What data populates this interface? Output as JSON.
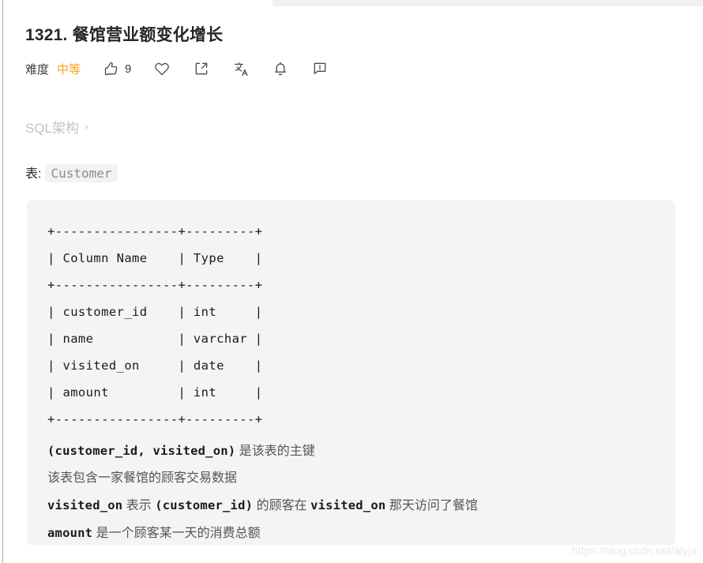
{
  "page": {
    "watermark": "https://blog.csdn.net/alyja"
  },
  "problem": {
    "title": "1321. 餐馆营业额变化增长",
    "difficulty_label": "难度",
    "difficulty_value": "中等",
    "difficulty_color": "#ffa116"
  },
  "actions": [
    {
      "name": "thumbs-up-icon",
      "label": "点赞",
      "count": "9"
    },
    {
      "name": "heart-icon",
      "label": "收藏",
      "count": ""
    },
    {
      "name": "share-icon",
      "label": "分享",
      "count": ""
    },
    {
      "name": "translate-icon",
      "label": "翻译",
      "count": ""
    },
    {
      "name": "bell-icon",
      "label": "订阅",
      "count": ""
    },
    {
      "name": "report-icon",
      "label": "反馈",
      "count": ""
    }
  ],
  "breadcrumb": {
    "label": "SQL架构",
    "chevron": "›"
  },
  "schema": {
    "caption_label": "表:",
    "table_name": "Customer",
    "ascii_table": "+----------------+---------+\n| Column Name    | Type    |\n+----------------+---------+\n| customer_id    | int     |\n| name           | varchar |\n| visited_on     | date    |\n| amount         | int     |\n+----------------+---------+",
    "columns": [
      {
        "name": "customer_id",
        "type": "int"
      },
      {
        "name": "name",
        "type": "varchar"
      },
      {
        "name": "visited_on",
        "type": "date"
      },
      {
        "name": "amount",
        "type": "int"
      }
    ],
    "column_headers": [
      "Column Name",
      "Type"
    ],
    "notes": [
      {
        "id": "pk",
        "mono1": "(customer_id, visited_on)",
        "text1": " 是该表的主键",
        "mono2": "",
        "text2": ""
      },
      {
        "id": "desc",
        "mono1": "",
        "text1": "该表包含一家餐馆的顾客交易数据",
        "mono2": "",
        "text2": ""
      },
      {
        "id": "visited",
        "mono1": "visited_on",
        "text1": " 表示 ",
        "mono2": "(customer_id)",
        "text2": " 的顾客在 ",
        "mono3": "visited_on",
        "text3": " 那天访问了餐馆"
      },
      {
        "id": "amount",
        "mono1": "amount",
        "text1": " 是一个顾客某一天的消费总额",
        "mono2": "",
        "text2": ""
      }
    ]
  }
}
